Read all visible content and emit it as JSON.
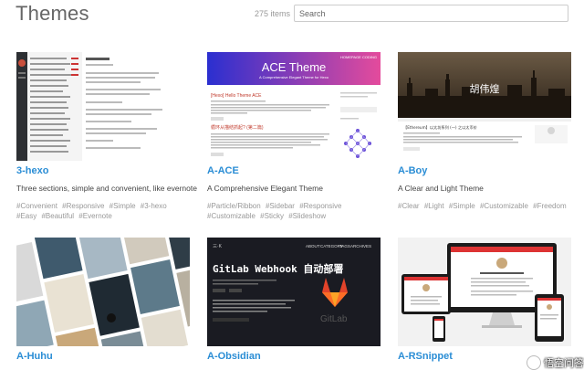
{
  "header": {
    "title": "Themes",
    "count": "275 items",
    "search_placeholder": "Search"
  },
  "themes": [
    {
      "name": "3-hexo",
      "desc": "Three sections, simple and convenient, like evernote",
      "tags": [
        "#Convenient",
        "#Responsive",
        "#Simple",
        "#3-hexo",
        "#Easy",
        "#Beautiful",
        "#Evernote"
      ]
    },
    {
      "name": "A-ACE",
      "desc": "A Comprehensive Elegant Theme",
      "tags": [
        "#Particle/Ribbon",
        "#Sidebar",
        "#Responsive",
        "#Customizable",
        "#Sticky",
        "#Slideshow"
      ],
      "preview": {
        "banner_title": "ACE Theme",
        "banner_sub": "A Comprehensive Elegant Theme for Hexo",
        "nav": [
          "HOMEPAGE",
          "CODING"
        ],
        "post_title": "[Hexo] Hello Theme ACE",
        "post2_title": "循环从描结抓起? (第二篇)"
      }
    },
    {
      "name": "A-Boy",
      "desc": "A Clear and Light Theme",
      "tags": [
        "#Clear",
        "#Light",
        "#Simple",
        "#Customizable",
        "#Freedom"
      ],
      "preview": {
        "banner_text": "胡伟煌",
        "post_title": "【Ethereum】以太坊系列 (一) 之以太币价"
      }
    },
    {
      "name": "A-Huhu",
      "desc": "",
      "tags": []
    },
    {
      "name": "A-Obsidian",
      "desc": "",
      "tags": [],
      "preview": {
        "nav": [
          "ABOUT",
          "CATEGORY",
          "TAGS",
          "ARCHIVES"
        ],
        "headline": "GitLab Webhook 自动部署",
        "logo_text": "GitLab"
      }
    },
    {
      "name": "A-RSnippet",
      "desc": "",
      "tags": []
    }
  ],
  "watermark": {
    "text": "悟空问答"
  },
  "colors": {
    "link": "#2a8dd5",
    "tag": "#999999",
    "title": "#666666",
    "ace_gradient_start": "#2b2fd0",
    "ace_gradient_end": "#e44b9c",
    "obsidian_bg": "#1a1b22",
    "gitlab_orange": "#e2432a"
  }
}
